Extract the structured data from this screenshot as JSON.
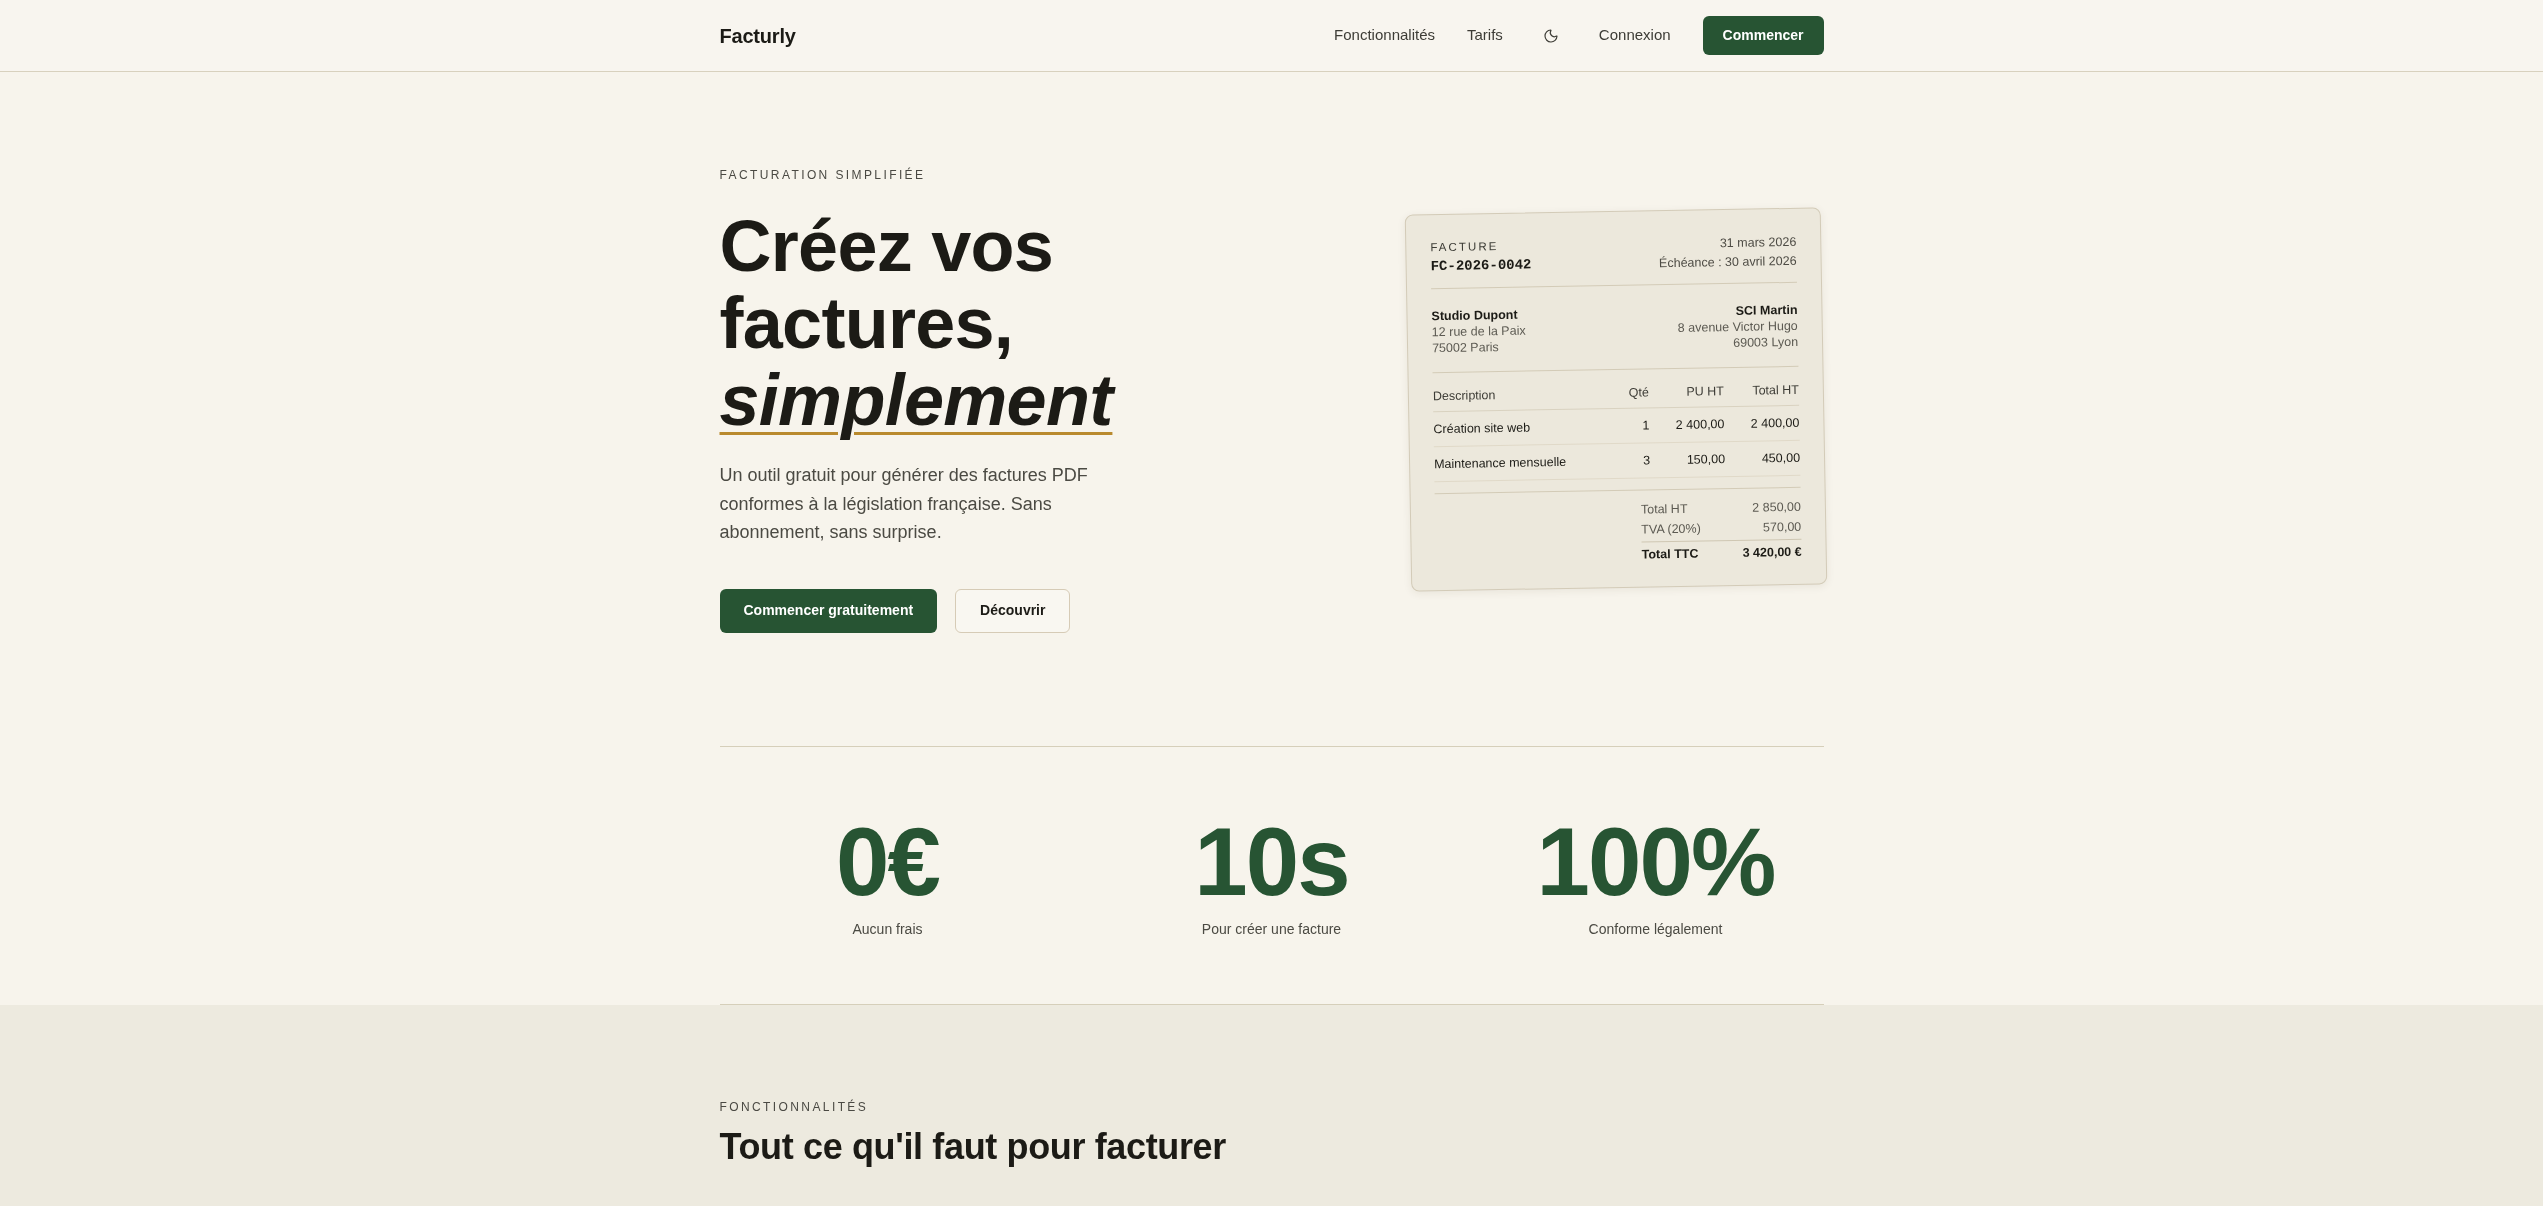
{
  "header": {
    "logo": "Facturly",
    "nav": [
      {
        "kind": "link",
        "label": "Fonctionnalités"
      },
      {
        "kind": "link",
        "label": "Tarifs"
      },
      {
        "kind": "theme_toggle"
      },
      {
        "kind": "link",
        "label": "Connexion"
      },
      {
        "kind": "button",
        "label": "Commencer"
      }
    ]
  },
  "hero": {
    "eyebrow": "FACTURATION SIMPLIFIÉE",
    "title": "Créez vos factures,",
    "title_emphasis": "simplement",
    "description": "Un outil gratuit pour générer des factures PDF conformes à la législation française. Sans abonnement, sans surprise.",
    "buttons": [
      {
        "kind": "primary",
        "label": "Commencer gratuitement"
      },
      {
        "kind": "secondary",
        "label": "Découvrir"
      }
    ]
  },
  "invoice": {
    "label": "FACTURE",
    "number": "FC-2026-0042",
    "date": "31 mars 2026",
    "due": "Échéance : 30 avril 2026",
    "seller": {
      "name": "Studio Dupont",
      "address": [
        "12 rue de la Paix",
        "75002 Paris"
      ]
    },
    "client": {
      "name": "SCI Martin",
      "address": [
        "8 avenue Victor Hugo",
        "69003 Lyon"
      ]
    },
    "columns": [
      "Description",
      "Qté",
      "PU HT",
      "Total HT"
    ],
    "rows": [
      {
        "cells": [
          "Création site web",
          "1",
          "2 400,00",
          "2 400,00"
        ]
      },
      {
        "cells": [
          "Maintenance mensuelle",
          "3",
          "150,00",
          "450,00"
        ]
      }
    ],
    "totals": [
      {
        "kind": "subtotal",
        "label": "Total HT",
        "value": "2 850,00"
      },
      {
        "kind": "subtotal",
        "label": "TVA (20%)",
        "value": "570,00"
      },
      {
        "kind": "grand",
        "label": "Total TTC",
        "value": "3 420,00 €"
      }
    ]
  },
  "stats": [
    {
      "value": "0€",
      "label": "Aucun frais"
    },
    {
      "value": "10s",
      "label": "Pour créer une facture"
    },
    {
      "value": "100%",
      "label": "Conforme légalement"
    }
  ],
  "features": {
    "eyebrow": "FONCTIONNALITÉS",
    "title": "Tout ce qu'il faut pour facturer"
  }
}
